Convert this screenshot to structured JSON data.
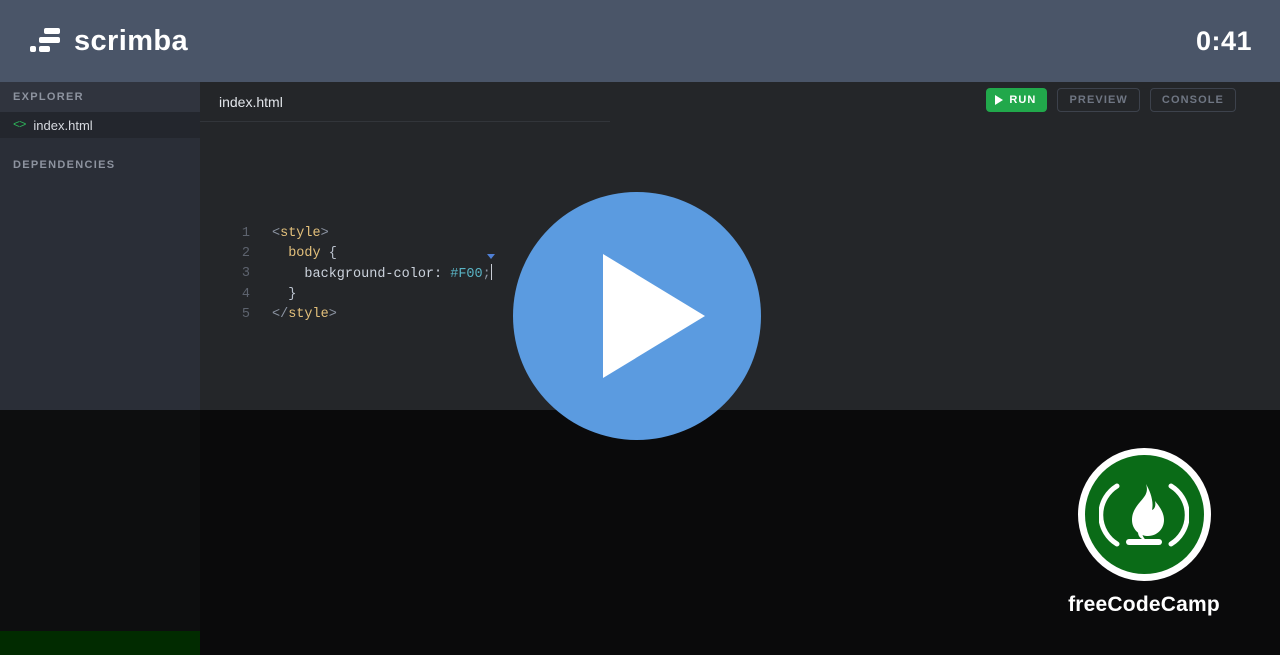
{
  "header": {
    "brand_name": "scrimba",
    "brand_mark_icon": "scrimba-logo-icon",
    "timer": "0:41"
  },
  "sidebar": {
    "sections": [
      {
        "title": "EXPLORER"
      },
      {
        "title": "DEPENDENCIES"
      }
    ],
    "files": [
      {
        "icon": "code-brackets-icon",
        "icon_glyph": "<>",
        "label": "index.html"
      }
    ]
  },
  "editor": {
    "tab": {
      "label": "index.html"
    },
    "toolbar": {
      "run_label": "RUN",
      "run_icon": "play-icon",
      "preview_label": "PREVIEW",
      "console_label": "CONSOLE"
    },
    "code": {
      "lines": [
        {
          "number": "1",
          "tokens": [
            {
              "text": "<",
              "type": "punc"
            },
            {
              "text": "style",
              "type": "tag"
            },
            {
              "text": ">",
              "type": "punc"
            }
          ]
        },
        {
          "number": "2",
          "tokens": [
            {
              "text": "  ",
              "type": "plain"
            },
            {
              "text": "body",
              "type": "sel"
            },
            {
              "text": " {",
              "type": "brace"
            }
          ]
        },
        {
          "number": "3",
          "tokens": [
            {
              "text": "    ",
              "type": "plain"
            },
            {
              "text": "background-color",
              "type": "prop"
            },
            {
              "text": ": ",
              "type": "prop"
            },
            {
              "text": "#F00",
              "type": "val"
            },
            {
              "text": ";",
              "type": "semi"
            }
          ]
        },
        {
          "number": "4",
          "tokens": [
            {
              "text": "  }",
              "type": "brace"
            }
          ]
        },
        {
          "number": "5",
          "tokens": [
            {
              "text": "</",
              "type": "punc"
            },
            {
              "text": "style",
              "type": "tag"
            },
            {
              "text": ">",
              "type": "punc"
            }
          ]
        }
      ]
    }
  },
  "overlay": {
    "play_icon": "play-triangle-icon"
  },
  "branding": {
    "fcc_name": "freeCodeCamp",
    "fcc_icon": "freecodecamp-flame-icon"
  },
  "colors": {
    "header_bg": "#4a5568",
    "sidebar_bg": "#2a2e37",
    "editor_bg": "#242629",
    "stage_bg": "#0a0a0b",
    "run_green": "#21a84b",
    "play_blue": "#5b9be0",
    "fcc_green": "#0a6b17",
    "progress_green": "#012b00"
  }
}
